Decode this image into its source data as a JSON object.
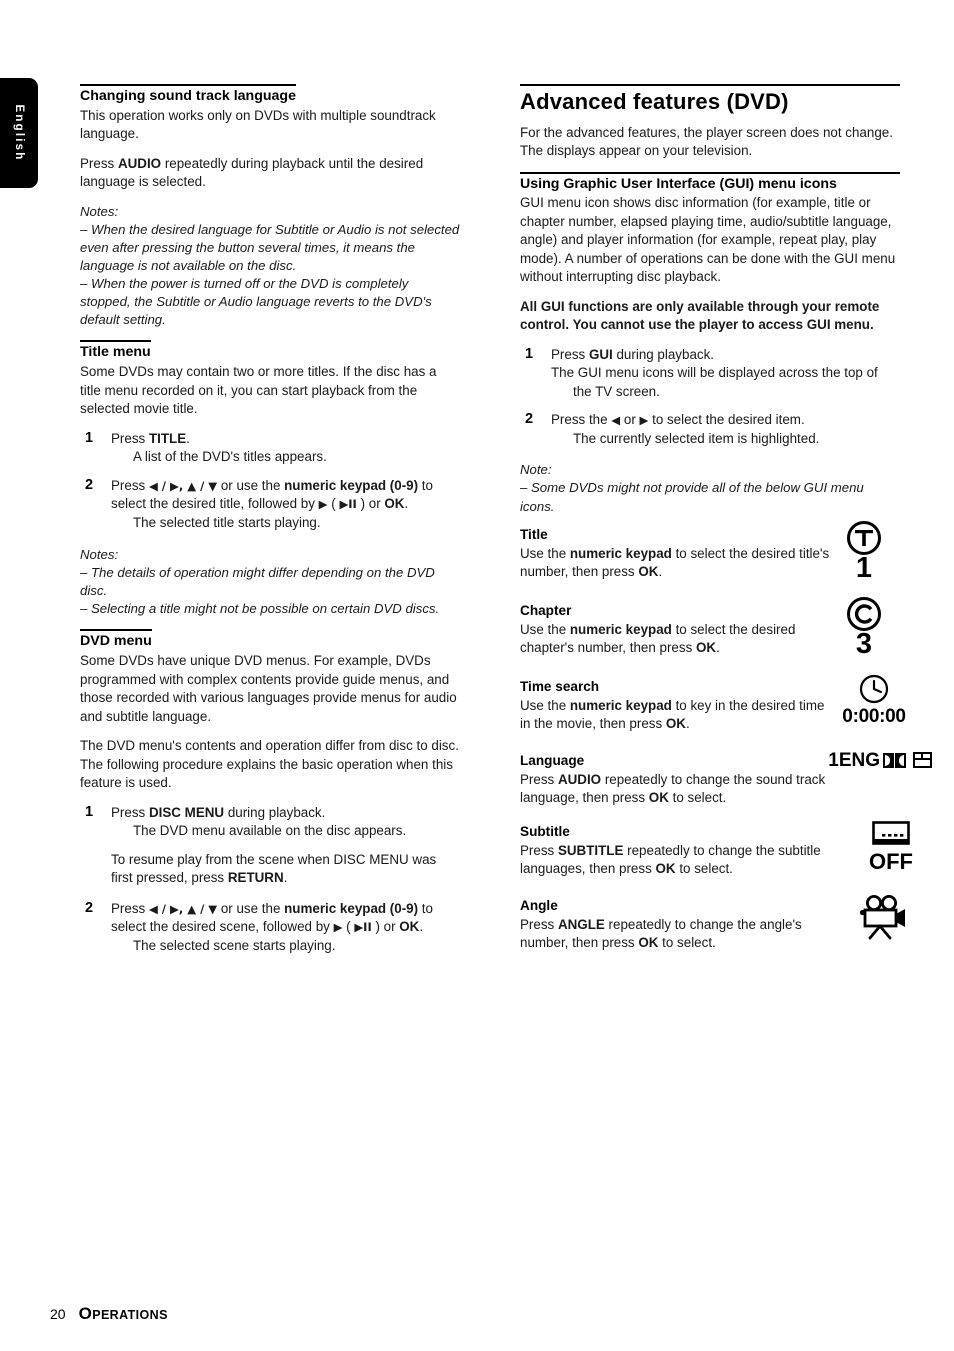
{
  "side_tab": {
    "label": "English"
  },
  "left_column": {
    "section1": {
      "heading": "Changing sound track language",
      "para1": "This operation works only on DVDs with multiple soundtrack language.",
      "para2_pre": "Press ",
      "para2_bold": "AUDIO",
      "para2_post": " repeatedly during playback until the desired language is selected.",
      "notes_label": "Notes:",
      "note1": "–  When the desired language for Subtitle or Audio is not selected even after pressing the button several times, it means the language is not available on the disc.",
      "note2": "–  When the power is turned off or the DVD is completely stopped, the Subtitle or Audio language reverts to the DVD's default setting."
    },
    "section2": {
      "heading": "Title menu",
      "para1": "Some DVDs may contain two or more titles. If the disc has a title menu recorded on it, you can start playback from the selected movie title.",
      "step1_num": "1",
      "step1_pre": "Press ",
      "step1_bold": "TITLE",
      "step1_post": ".",
      "step1_sub": "A list of the DVD's titles appears.",
      "step2_num": "2",
      "step2_a": "Press ",
      "step2_arrows1": "◀ / ▶, ▲ / ▼",
      "step2_b": " or use the ",
      "step2_bold1": "numeric keypad (0-9)",
      "step2_c": " to select the desired title, followed by ",
      "step2_arrows2": "▶",
      "step2_d": " ( ",
      "step2_arrows3": "▶II",
      "step2_e": " ) or ",
      "step2_bold2": "OK",
      "step2_f": ".",
      "step2_sub": "The selected title starts playing.",
      "notes_label": "Notes:",
      "note1": "–  The details of operation might differ depending on the DVD disc.",
      "note2": "–  Selecting a title might not be possible on certain DVD discs."
    },
    "section3": {
      "heading": "DVD menu",
      "para1": "Some DVDs have unique DVD menus. For example, DVDs programmed with complex contents provide guide menus, and those recorded with various languages provide menus for audio and subtitle language.",
      "para2": "The DVD menu's contents and operation differ from disc to disc. The following procedure explains the basic operation when this feature is used.",
      "step1_num": "1",
      "step1_pre": "Press ",
      "step1_bold": "DISC MENU",
      "step1_post": " during playback.",
      "step1_sub": "The DVD menu available on the disc appears.",
      "step1_extra_pre": "To resume play from the scene when DISC MENU was first pressed, press ",
      "step1_extra_bold": "RETURN",
      "step1_extra_post": ".",
      "step2_num": "2",
      "step2_a": "Press ",
      "step2_arrows1": "◀ / ▶, ▲ / ▼",
      "step2_b": " or use the ",
      "step2_bold1": "numeric keypad (0-9)",
      "step2_c": " to select the desired scene, followed by ",
      "step2_arrows2": "▶",
      "step2_d": " ( ",
      "step2_arrows3": "▶II",
      "step2_e": " ) or ",
      "step2_bold2": "OK",
      "step2_f": ".",
      "step2_sub": "The selected scene starts playing."
    }
  },
  "right_column": {
    "title": "Advanced features (DVD)",
    "intro": "For the advanced features, the player screen does not change. The displays appear on your television.",
    "gui_section": {
      "heading": "Using Graphic User Interface (GUI) menu icons",
      "para1": "GUI menu icon shows disc information (for example, title or chapter number, elapsed playing time, audio/subtitle language, angle) and player information (for example, repeat play, play mode).  A number of operations can be done with the GUI menu without interrupting disc playback.",
      "warning": "All GUI functions are only available through your remote control. You cannot use the player to access GUI menu.",
      "step1_num": "1",
      "step1_pre": "Press ",
      "step1_bold": "GUI",
      "step1_post": " during playback.",
      "step1_sub": "The GUI menu icons will be displayed across the top of the TV screen.",
      "step2_num": "2",
      "step2_a": "Press the ",
      "step2_arrow1": "◀",
      "step2_b": " or ",
      "step2_arrow2": "▶",
      "step2_c": " to select the desired item.",
      "step2_sub": "The currently selected item is highlighted.",
      "note_label": "Note:",
      "note1": "–  Some DVDs might not provide all of the below GUI menu icons."
    },
    "items": [
      {
        "heading": "Title",
        "text_a": "Use the ",
        "text_bold1": "numeric keypad",
        "text_b": " to select the desired title's number, then press ",
        "text_bold2": "OK",
        "text_c": ".",
        "icon": "title-circle-t-icon",
        "icon_letter": "T",
        "icon_value": "1"
      },
      {
        "heading": "Chapter",
        "text_a": "Use the ",
        "text_bold1": "numeric keypad",
        "text_b": " to select the desired chapter's number, then press ",
        "text_bold2": "OK",
        "text_c": ".",
        "icon": "chapter-circle-c-icon",
        "icon_letter": "C",
        "icon_value": "3"
      },
      {
        "heading": "Time search",
        "text_a": "Use the ",
        "text_bold1": "numeric keypad",
        "text_b": " to key in the desired time in the movie, then press ",
        "text_bold2": "OK",
        "text_c": ".",
        "icon": "clock-icon",
        "icon_value": "0:00:00"
      },
      {
        "heading": "Language",
        "text_a": "Press ",
        "text_bold1": "AUDIO",
        "text_b": " repeatedly to change the sound track language, then press ",
        "text_bold2": "OK",
        "text_c": " to select.",
        "icon": "dolby-digital-icon",
        "icon_value": "1ENG"
      },
      {
        "heading": "Subtitle",
        "text_a": "Press ",
        "text_bold1": "SUBTITLE",
        "text_b": " repeatedly to change the subtitle languages, then press ",
        "text_bold2": "OK",
        "text_c": " to select.",
        "icon": "subtitle-screen-icon",
        "icon_value": "OFF"
      },
      {
        "heading": "Angle",
        "text_a": "Press ",
        "text_bold1": "ANGLE",
        "text_b": " repeatedly to change the angle's number, then press ",
        "text_bold2": "OK",
        "text_c": " to select.",
        "icon": "movie-camera-icon",
        "icon_value": ""
      }
    ]
  },
  "footer": {
    "page_number": "20",
    "section_cap": "O",
    "section_rest": "PERATIONS"
  }
}
